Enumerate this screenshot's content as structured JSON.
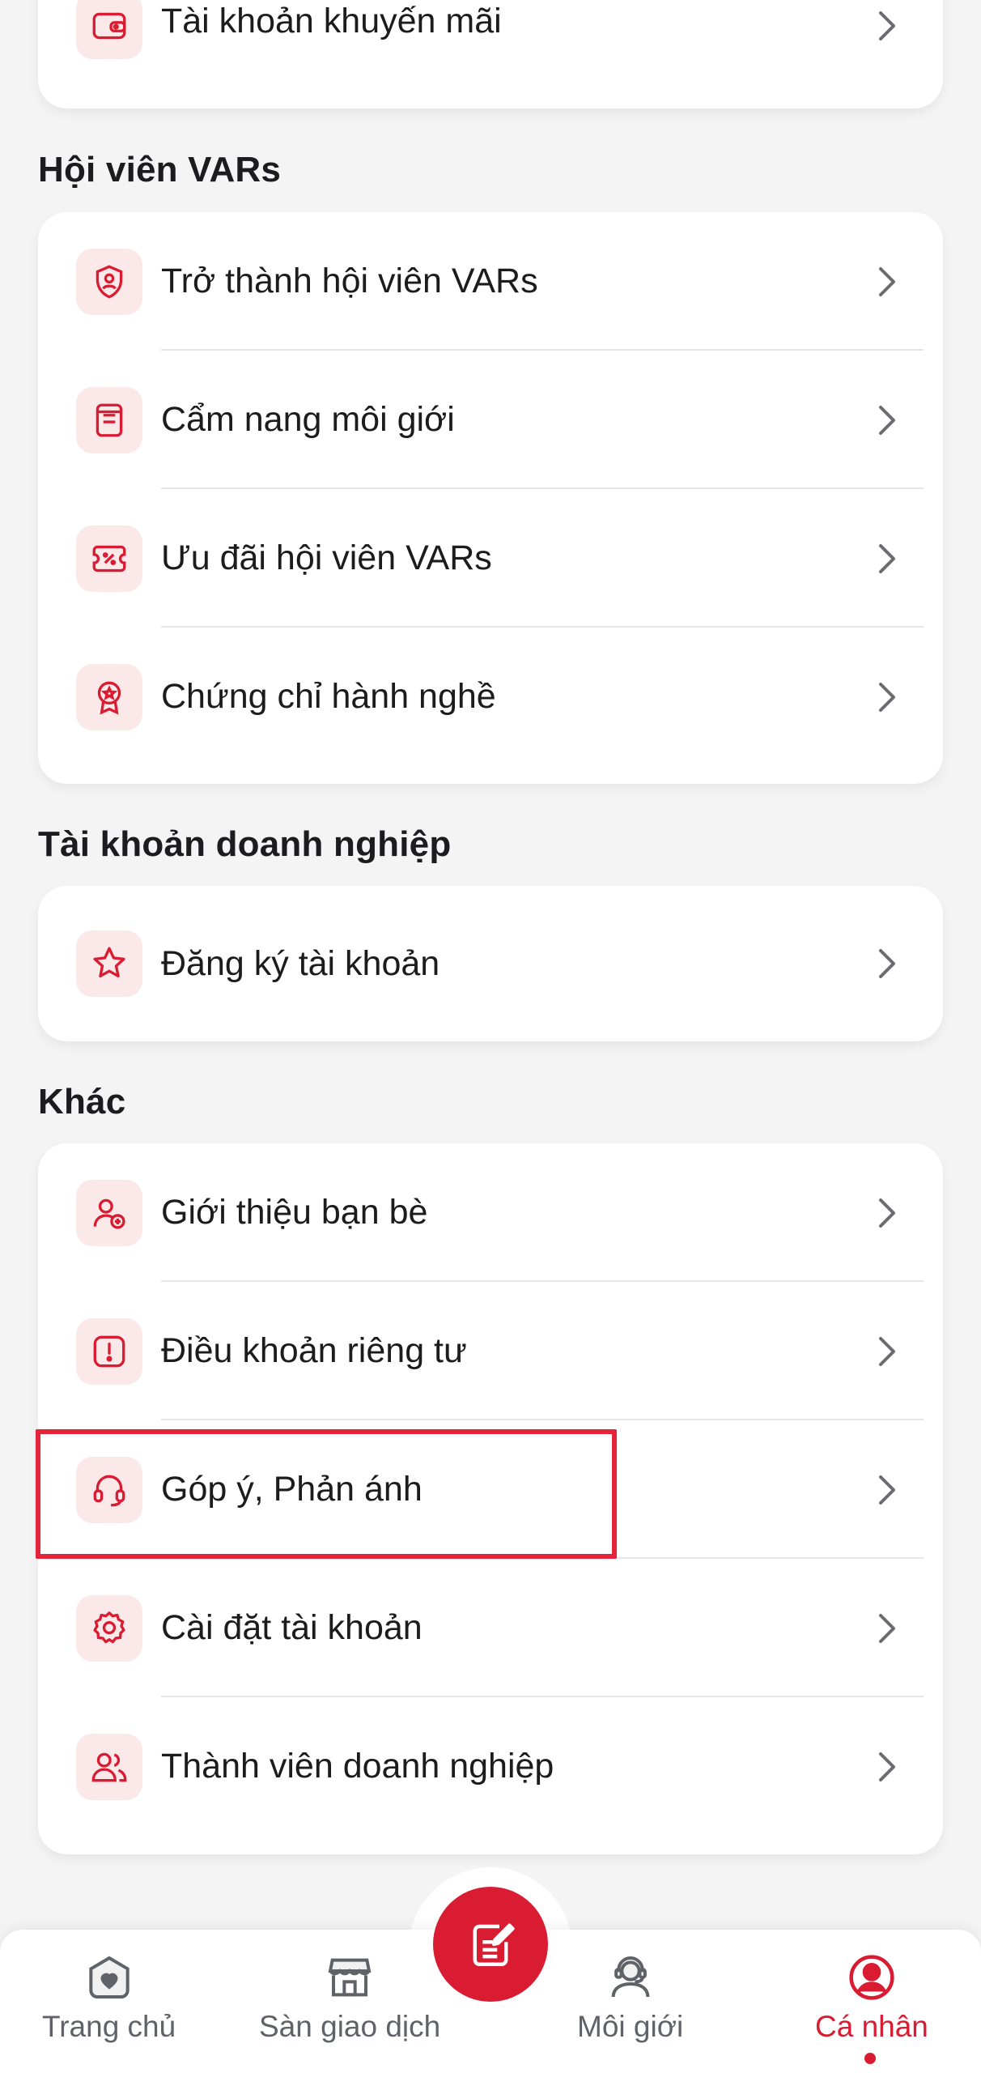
{
  "colors": {
    "accent": "#d91c32",
    "icon_bg": "#fbe9ea",
    "background": "#f4f4f5"
  },
  "top_card": {
    "label": "Tài khoản khuyến mãi",
    "icon": "promo-wallet-icon"
  },
  "sections": [
    {
      "title": "Hội viên VARs",
      "items": [
        {
          "label": "Trở thành hội viên VARs",
          "icon": "member-shield-icon"
        },
        {
          "label": "Cẩm nang môi giới",
          "icon": "handbook-icon"
        },
        {
          "label": "Ưu đãi hội viên VARs",
          "icon": "discount-ticket-icon"
        },
        {
          "label": "Chứng chỉ hành nghề",
          "icon": "certificate-badge-icon"
        }
      ]
    },
    {
      "title": "Tài khoản doanh nghiệp",
      "items": [
        {
          "label": "Đăng ký tài khoản",
          "icon": "star-icon"
        }
      ]
    },
    {
      "title": "Khác",
      "items": [
        {
          "label": "Giới thiệu bạn bè",
          "icon": "invite-user-icon"
        },
        {
          "label": "Điều khoản riêng tư",
          "icon": "alert-icon"
        },
        {
          "label": "Góp ý, Phản ánh",
          "icon": "headset-icon"
        },
        {
          "label": "Cài đặt tài khoản",
          "icon": "gear-icon"
        },
        {
          "label": "Thành viên doanh nghiệp",
          "icon": "users-icon"
        }
      ]
    }
  ],
  "bottom_nav": {
    "items": [
      {
        "label": "Trang chủ",
        "icon": "home-heart-icon"
      },
      {
        "label": "Sàn giao dịch",
        "icon": "store-icon"
      },
      {
        "label": "Môi giới",
        "icon": "agent-icon"
      },
      {
        "label": "Cá nhân",
        "icon": "profile-icon",
        "active": true
      }
    ],
    "center_action_icon": "edit-note-icon"
  }
}
